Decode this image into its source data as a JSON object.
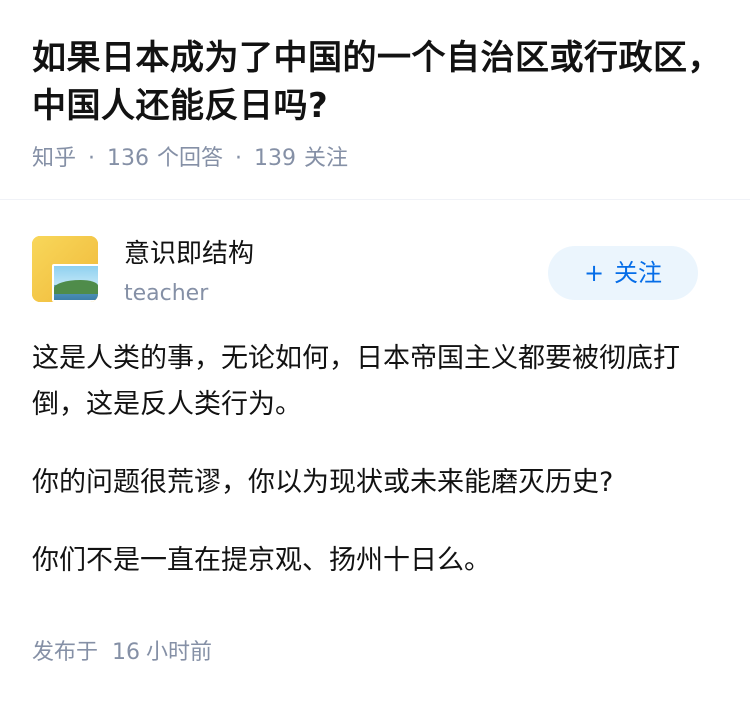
{
  "question": {
    "title": "如果日本成为了中国的一个自治区或行政区，中国人还能反日吗?",
    "source": "知乎",
    "answers_count": "136",
    "answers_label": "个回答",
    "followers_count": "139",
    "followers_label": "关注",
    "separator": "·"
  },
  "answer": {
    "author": {
      "name": "意识即结构",
      "bio": "teacher"
    },
    "follow_button": {
      "icon": "+",
      "label": "关注"
    },
    "paragraphs": [
      "这是人类的事，无论如何，日本帝国主义都要被彻底打倒，这是反人类行为。",
      "你的问题很荒谬，你以为现状或未来能磨灭历史?",
      "你们不是一直在提京观、扬州十日么。"
    ],
    "published": {
      "prefix": "发布于",
      "value": "16",
      "unit": "小时前"
    }
  },
  "colors": {
    "text": "#121212",
    "muted": "#8590a6",
    "accent": "#056de8",
    "accent_bg": "#ebf5fd"
  },
  "icons": {
    "avatar": "folder-photo-avatar"
  }
}
